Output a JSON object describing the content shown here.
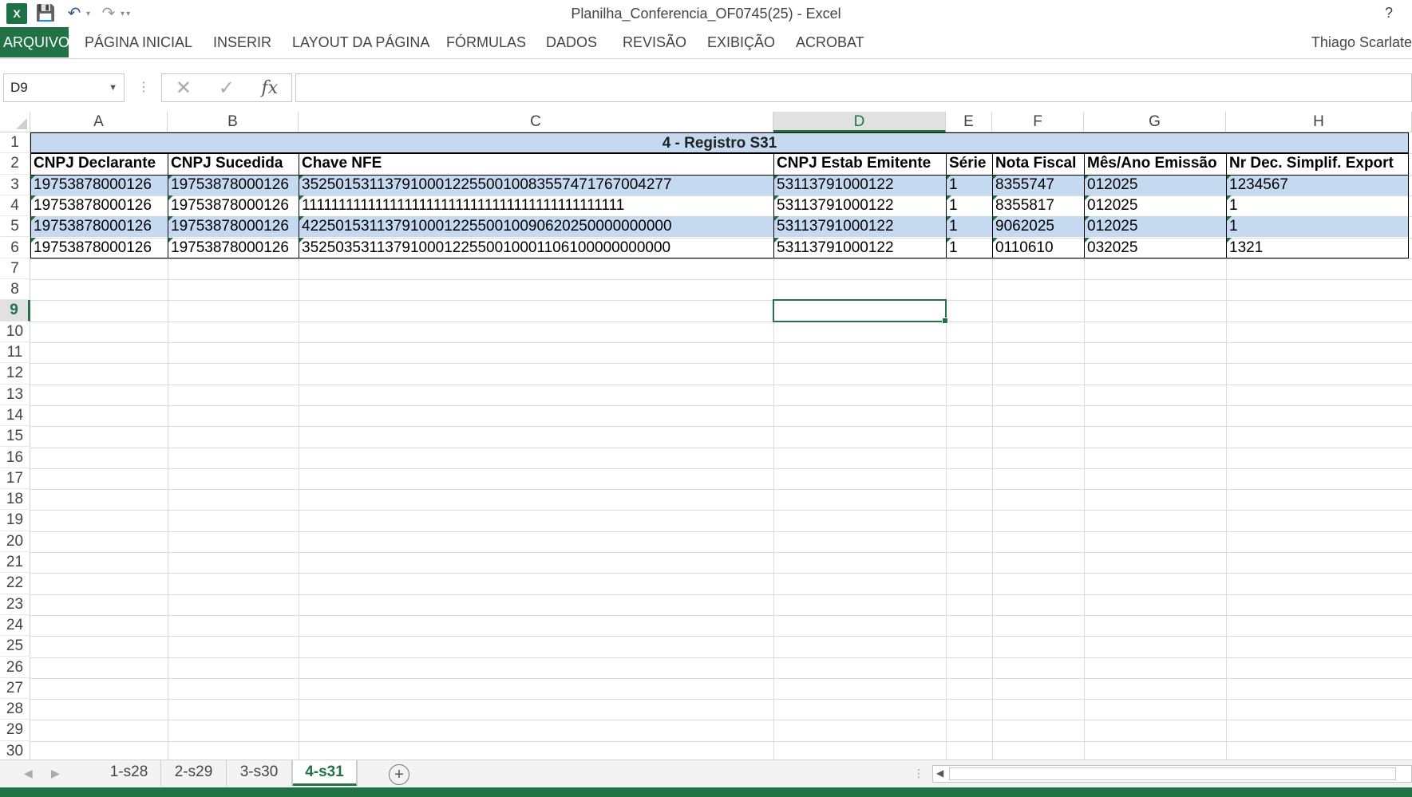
{
  "window": {
    "title": "Planilha_Conferencia_OF0745(25) - Excel",
    "help": "?",
    "app_icon": "X"
  },
  "ribbon": {
    "tabs": [
      "ARQUIVO",
      "PÁGINA INICIAL",
      "INSERIR",
      "LAYOUT DA PÁGINA",
      "FÓRMULAS",
      "DADOS",
      "REVISÃO",
      "EXIBIÇÃO",
      "ACROBAT"
    ],
    "user": "Thiago Scarlate"
  },
  "formula_bar": {
    "name_box": "D9",
    "formula": ""
  },
  "grid": {
    "columns": [
      "A",
      "B",
      "C",
      "D",
      "E",
      "F",
      "G",
      "H"
    ],
    "selected_column": "D",
    "selected_row": 9,
    "rows": [
      "1",
      "2",
      "3",
      "4",
      "5",
      "6",
      "7",
      "8",
      "9",
      "10",
      "11",
      "12",
      "13",
      "14",
      "15",
      "16",
      "17",
      "18",
      "19",
      "20",
      "21",
      "22",
      "23",
      "24",
      "25",
      "26",
      "27",
      "28",
      "29",
      "30"
    ]
  },
  "table": {
    "banner": "4 - Registro S31",
    "headers": [
      "CNPJ Declarante",
      "CNPJ Sucedida",
      "Chave NFE",
      "CNPJ Estab Emitente",
      "Série",
      "Nota Fiscal",
      "Mês/Ano Emissão",
      "Nr Dec. Simplif. Export"
    ],
    "rows": [
      [
        "19753878000126",
        "19753878000126",
        "35250153113791000122550010083557471767004277",
        "53113791000122",
        "1",
        "8355747",
        "012025",
        "1234567"
      ],
      [
        "19753878000126",
        "19753878000126",
        "11111111111111111111111111111111111111111111",
        "53113791000122",
        "1",
        "8355817",
        "012025",
        "1"
      ],
      [
        "19753878000126",
        "19753878000126",
        "42250153113791000122550010090620250000000000",
        "53113791000122",
        "1",
        "9062025",
        "012025",
        "1"
      ],
      [
        "19753878000126",
        "19753878000126",
        "35250353113791000122550010001106100000000000",
        "53113791000122",
        "1",
        "0110610",
        "032025",
        "1321"
      ]
    ]
  },
  "sheets": {
    "tabs": [
      "1-s28",
      "2-s29",
      "3-s30",
      "4-s31"
    ],
    "active": "4-s31",
    "add": "+"
  },
  "colors": {
    "accent": "#217346",
    "band": "#c5d9f1"
  }
}
